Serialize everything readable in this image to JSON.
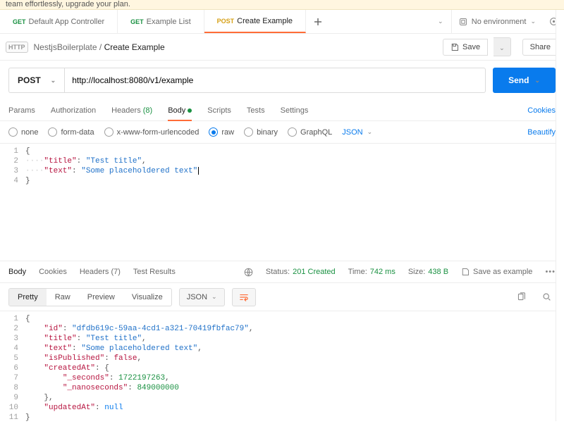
{
  "banner": {
    "text": "team effortlessly, upgrade your plan."
  },
  "tabs": [
    {
      "method": "GET",
      "methodClass": "method-get",
      "label": "Default App Controller"
    },
    {
      "method": "GET",
      "methodClass": "method-get",
      "label": "Example List"
    },
    {
      "method": "POST",
      "methodClass": "method-post",
      "label": "Create Example"
    }
  ],
  "env": {
    "label": "No environment"
  },
  "breadcrumb": {
    "parent": "NestjsBoilerplate",
    "sep": "/",
    "current": "Create Example"
  },
  "actions": {
    "save": "Save",
    "share": "Share"
  },
  "request": {
    "method": "POST",
    "url": "http://localhost:8080/v1/example",
    "send": "Send",
    "tabs": {
      "params": "Params",
      "auth": "Authorization",
      "headers_label": "Headers",
      "headers_count": "(8)",
      "body": "Body",
      "scripts": "Scripts",
      "tests": "Tests",
      "settings": "Settings",
      "cookies": "Cookies"
    },
    "body_opts": {
      "none": "none",
      "form": "form-data",
      "urlenc": "x-www-form-urlencoded",
      "raw": "raw",
      "binary": "binary",
      "graphql": "GraphQL",
      "json": "JSON",
      "beautify": "Beautify"
    },
    "body_json": {
      "title_key": "\"title\"",
      "title_val": "\"Test title\"",
      "text_key": "\"text\"",
      "text_val": "\"Some placeholdered text\""
    }
  },
  "response": {
    "tabs": {
      "body": "Body",
      "cookies": "Cookies",
      "headers_label": "Headers",
      "headers_count": "(7)",
      "tests": "Test Results"
    },
    "status_label": "Status:",
    "status_val": "201 Created",
    "time_label": "Time:",
    "time_val": "742 ms",
    "size_label": "Size:",
    "size_val": "438 B",
    "save_example": "Save as example",
    "view": {
      "pretty": "Pretty",
      "raw": "Raw",
      "preview": "Preview",
      "visualize": "Visualize",
      "format": "JSON"
    },
    "json": {
      "id_key": "\"id\"",
      "id_val": "\"dfdb619c-59aa-4cd1-a321-70419fbfac79\"",
      "title_key": "\"title\"",
      "title_val": "\"Test title\"",
      "text_key": "\"text\"",
      "text_val": "\"Some placeholdered text\"",
      "pub_key": "\"isPublished\"",
      "pub_val": "false",
      "cat_key": "\"createdAt\"",
      "sec_key": "\"_seconds\"",
      "sec_val": "1722197263",
      "nano_key": "\"_nanoseconds\"",
      "nano_val": "849000000",
      "uat_key": "\"updatedAt\"",
      "uat_val": "null"
    }
  }
}
